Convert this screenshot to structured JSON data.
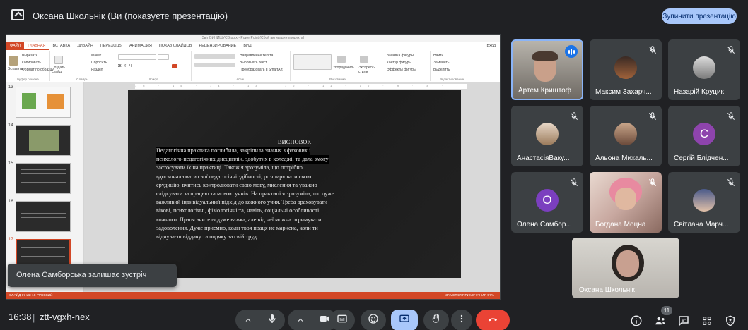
{
  "header": {
    "title": "Оксана Школьнік (Ви (показуєте презентацію)",
    "stop_button": "Зупинити презентацію"
  },
  "powerpoint": {
    "window_title": "Звіт ВИНИЩУЄВ.pptx - PowerPoint (Сбой активации продукта)",
    "tabs": [
      "ФАЙЛ",
      "ГЛАВНАЯ",
      "ВСТАВКА",
      "ДИЗАЙН",
      "ПЕРЕХОДЫ",
      "АНИМАЦИЯ",
      "ПОКАЗ СЛАЙДОВ",
      "РЕЦЕНЗИРОВАНИЕ",
      "ВИД"
    ],
    "login": "Вход",
    "ribbon": {
      "paste": "Вставить",
      "cut": "Вырезать",
      "copy": "Копировать",
      "format_painter": "Формат по образцу",
      "clipboard": "Буфер обмена",
      "layout": "Макет",
      "reset": "Сбросить",
      "section": "Раздел",
      "new_slide": "Создать слайд",
      "slides": "Слайды",
      "font": "Шрифт",
      "text_direction": "Направление текста",
      "align_text": "Выровнять текст",
      "smartart": "Преобразовать в SmartArt",
      "paragraph": "Абзац",
      "arrange": "Упорядочить",
      "quick_styles": "Экспресс-стили",
      "drawing": "Рисование",
      "shape_fill": "Заливка фигуры",
      "shape_outline": "Контур фигуры",
      "shape_effects": "Эффекты фигуры",
      "find": "Найти",
      "replace": "Заменить",
      "select": "Выделить",
      "editing": "Редактирование"
    },
    "thumbnails": [
      "13",
      "14",
      "15",
      "16",
      "17"
    ],
    "ruler": "16 · 15 · 14 · 13 · 12 · 11 · 10 · 9 · 8 · 7 · 6 · 5 · 4 · 3 · 2 · 1 · 0 · 1 · 2 · 3 · 4 · 5 · 6 · 7 · 8 · 9 · 10 · 11 · 12 · 13 · 14 · 15 · 16",
    "slide": {
      "heading": "ВИСНОВОК",
      "lines": [
        "Педагогічна практика поглибила, закріпила знання з фахових і",
        "психолого-педагогічних дисциплін, здобутих в коледжі, та дала змогу",
        "застосувати їх на практиці. Також я зрозуміла, що потрібно",
        "вдосконалювати свої педагогічні здібності, розширювати свою",
        "ерудицію, вчитись контролювати свою мову, мислення та уважно",
        "слідкувати за працею та мовою учнів. На практиці я зрозуміла, що дуже",
        "важливий індивідуальний підхід до кожного учня. Треба враховувати",
        "вікові, психологічні, фізіологічні та, навіть, соціальні особливості",
        "кожного. Праця вчителя дуже важка, але від неї можна отримувати",
        "задоволення. Дуже приємно, коли твоя праця не марнена, коли ти",
        "відчуваєш віддачу та подяку за свій труд."
      ]
    },
    "status": {
      "left": "СЛАЙД 17 ИЗ 18   РУССКИЙ",
      "right": "ЗАМЕТКИ   ПРИМЕЧАНИЯ   57%"
    }
  },
  "toast": "Олена Самборська залишає зустріч",
  "participants": [
    {
      "name": "Артем Криштоф",
      "speaking": true
    },
    {
      "name": "Максим Захарч...",
      "muted": true
    },
    {
      "name": "Назарій Круцик",
      "muted": true
    },
    {
      "name": "АнастасіяВаку...",
      "muted": true
    },
    {
      "name": "Альона Михаль...",
      "muted": true
    },
    {
      "name": "Сергій Блідчен...",
      "muted": true,
      "initial": "С",
      "color": "#8e44ad"
    },
    {
      "name": "Олена Самбор...",
      "muted": true,
      "initial": "О",
      "color": "#7b3fbf"
    },
    {
      "name": "Богдана Моцна",
      "muted": true
    },
    {
      "name": "Світлана Марч...",
      "muted": true
    },
    {
      "name": "Оксана Школьнік"
    }
  ],
  "bottom": {
    "time": "16:38",
    "separator": "|",
    "meeting_code": "ztt-vgxh-nex",
    "people_count": "11"
  },
  "colors": {
    "background": "#202124",
    "accent": "#a8c7fa",
    "end_call": "#ea4335",
    "powerpoint": "#d24726"
  }
}
